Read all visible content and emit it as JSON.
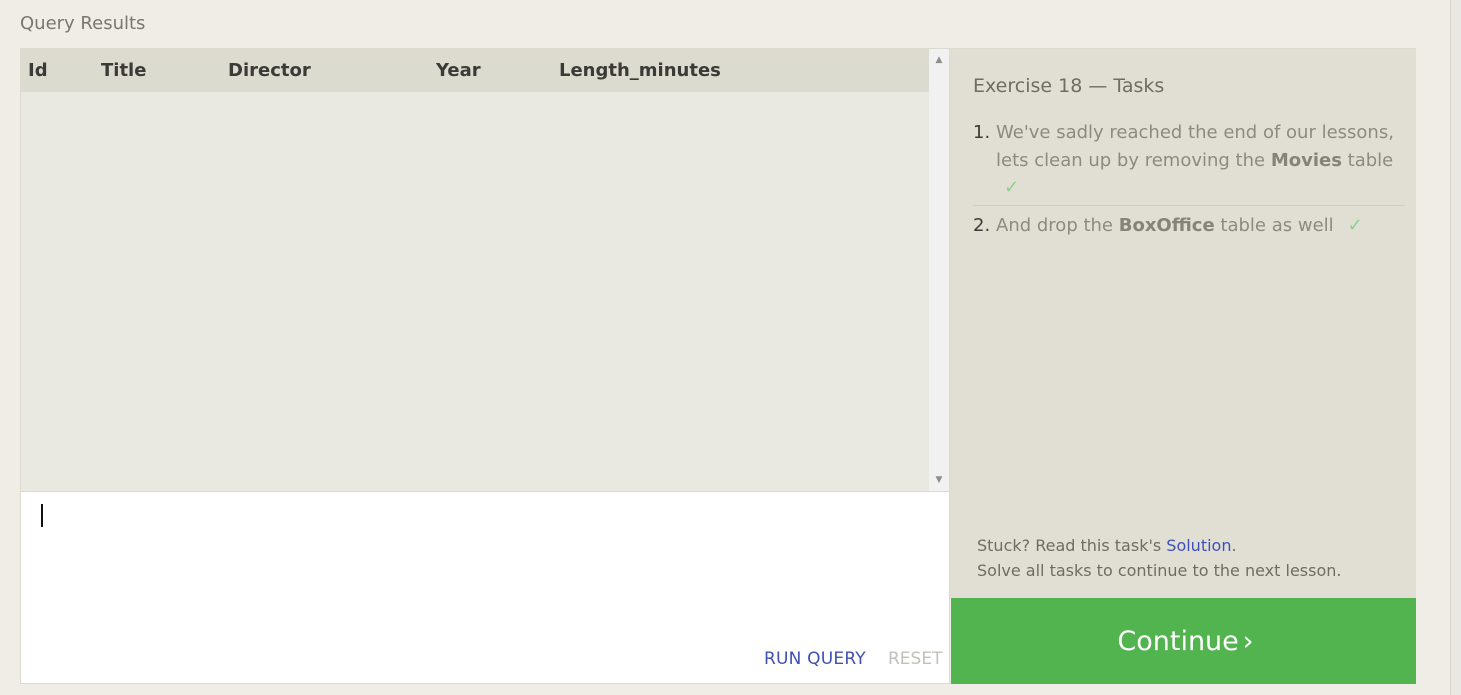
{
  "results": {
    "label": "Query Results",
    "columns": [
      "Id",
      "Title",
      "Director",
      "Year",
      "Length_minutes"
    ],
    "scroll_up_glyph": "▲",
    "scroll_down_glyph": "▼"
  },
  "editor": {
    "value": ""
  },
  "actions": {
    "run_label": "RUN QUERY",
    "reset_label": "RESET"
  },
  "tasks": {
    "title": "Exercise 18 — Tasks",
    "items": [
      {
        "number": "1.",
        "before": "We've sadly reached the end of our lessons, lets clean up by removing the ",
        "bold": "Movies",
        "after": " table",
        "check": "✓"
      },
      {
        "number": "2.",
        "before": "And drop the ",
        "bold": "BoxOffice",
        "after": " table as well",
        "check": "✓"
      }
    ],
    "help_prefix": "Stuck? Read this task's ",
    "help_link": "Solution",
    "help_suffix": ".",
    "help_line2": "Solve all tasks to continue to the next lesson."
  },
  "continue": {
    "label": "Continue",
    "chevron": "›"
  },
  "colors": {
    "accent_green": "#51b44e",
    "link_blue": "#3f51b5",
    "check_green": "#8ecf8e"
  }
}
